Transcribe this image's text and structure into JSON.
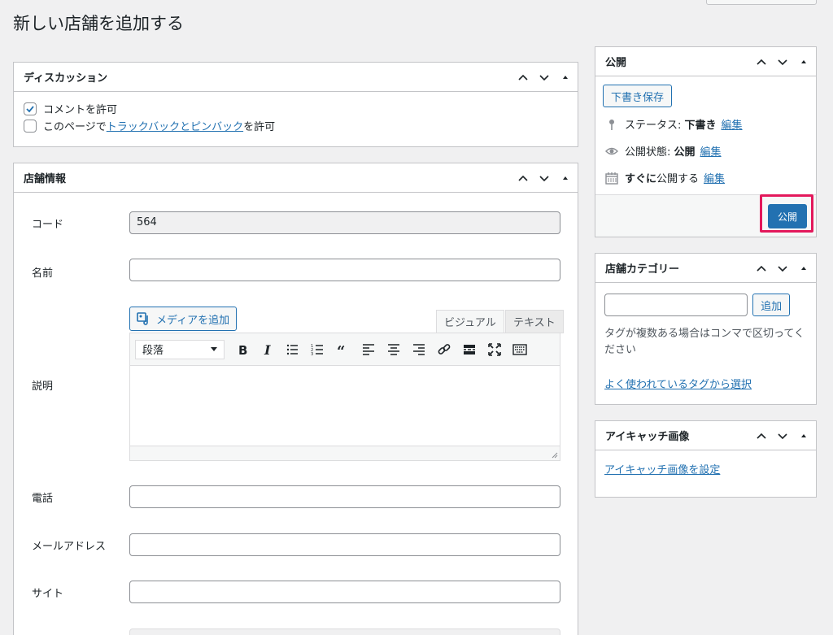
{
  "page": {
    "title": "新しい店舗を追加する"
  },
  "discussion": {
    "title": "ディスカッション",
    "allow_comments": {
      "label": "コメントを許可",
      "checked": true
    },
    "allow_pings": {
      "prefix": "このページで",
      "link": "トラックバックとピンバック",
      "suffix": "を許可",
      "checked": false
    }
  },
  "shop": {
    "title": "店舗情報",
    "code": {
      "label": "コード",
      "value": "564"
    },
    "name": {
      "label": "名前",
      "value": ""
    },
    "description": {
      "label": "説明",
      "add_media": "メディアを追加",
      "tab_visual": "ビジュアル",
      "tab_text": "テキスト",
      "format": "段落",
      "toolbar_icons": [
        "bold-icon",
        "italic-icon",
        "bulleted-list-icon",
        "numbered-list-icon",
        "blockquote-icon",
        "align-left-icon",
        "align-center-icon",
        "align-right-icon",
        "link-icon",
        "read-more-icon",
        "fullscreen-icon",
        "toolbar-toggle-icon"
      ]
    },
    "phone": {
      "label": "電話",
      "value": ""
    },
    "email": {
      "label": "メールアドレス",
      "value": ""
    },
    "site": {
      "label": "サイト",
      "value": ""
    }
  },
  "publish": {
    "title": "公開",
    "save_draft": "下書き保存",
    "status_label": "ステータス:",
    "status_value": "下書き",
    "visibility_label": "公開状態:",
    "visibility_value": "公開",
    "schedule_value": "すぐに",
    "schedule_suffix": "公開する",
    "edit": "編集",
    "publish_button": "公開",
    "highlight_color": "#e3185b"
  },
  "categories": {
    "title": "店舗カテゴリー",
    "input_value": "",
    "add_button": "追加",
    "help": "タグが複数ある場合はコンマで区切ってください",
    "popular_link": "よく使われているタグから選択"
  },
  "featured_image": {
    "title": "アイキャッチ画像",
    "set_link": "アイキャッチ画像を設定"
  },
  "colors": {
    "accent": "#2271b1",
    "background": "#f0f0f1",
    "border": "#c3c4c7"
  }
}
